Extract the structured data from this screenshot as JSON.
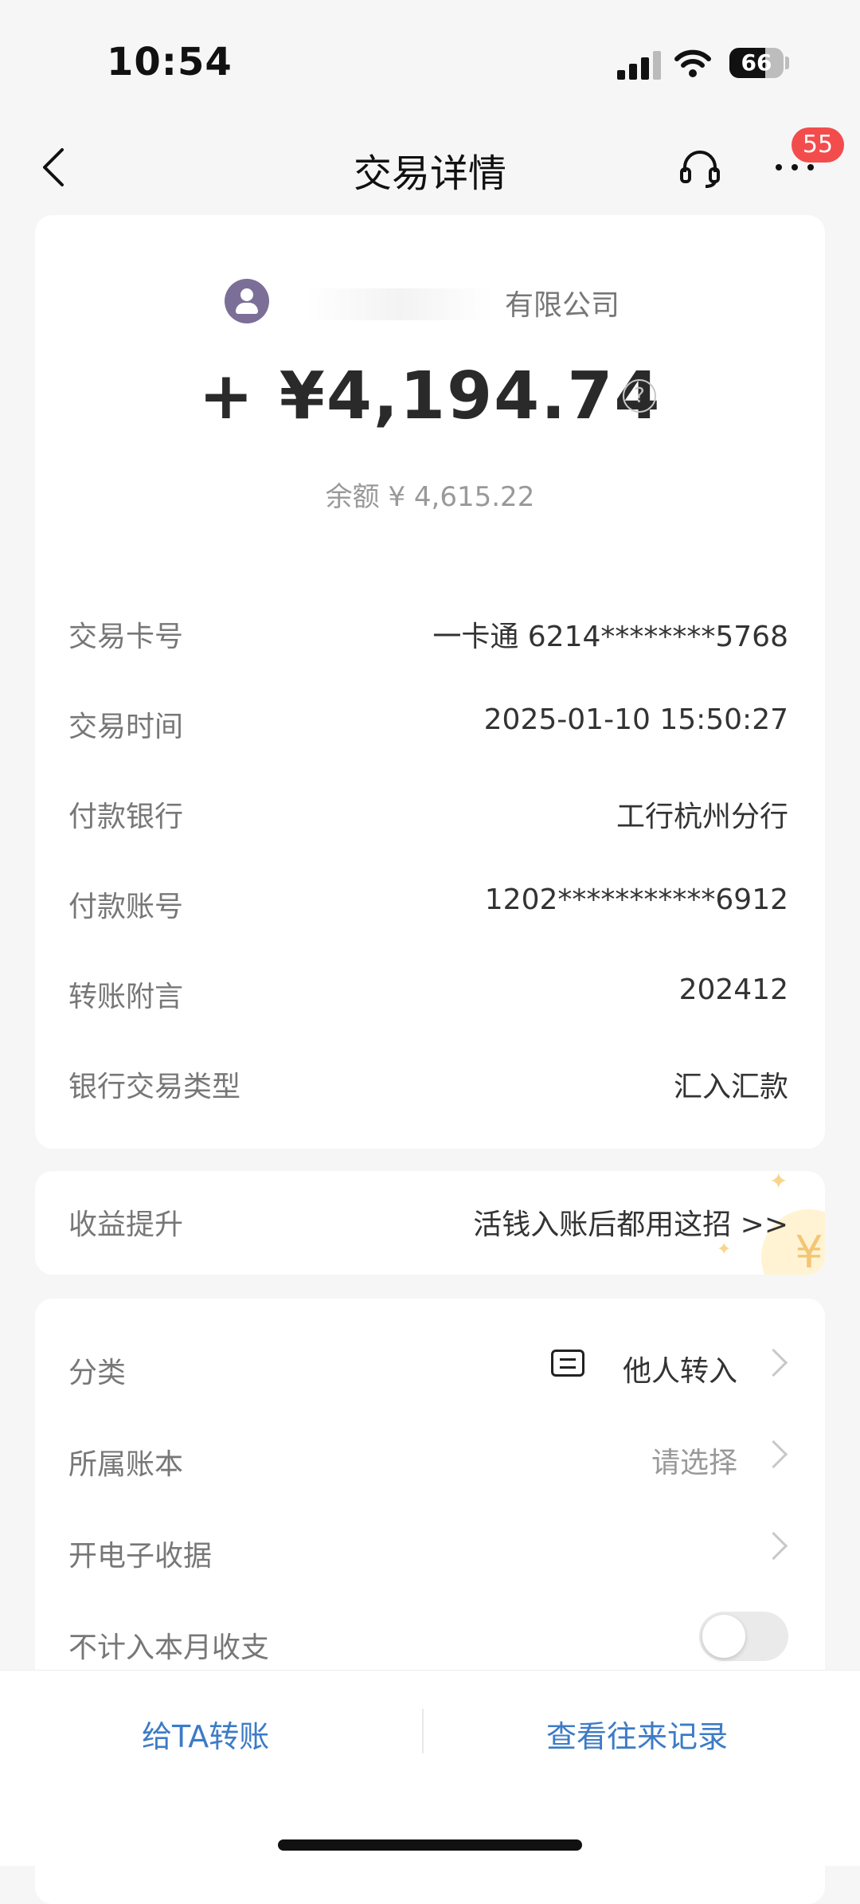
{
  "status_bar": {
    "time": "10:54",
    "battery": "66"
  },
  "header": {
    "title": "交易详情",
    "notification_count": "55"
  },
  "transaction": {
    "payer_name": "有限公司",
    "amount": "+ ¥4,194.74",
    "balance": "余额 ¥ 4,615.22"
  },
  "details": [
    {
      "label": "交易卡号",
      "value": "一卡通 6214********5768"
    },
    {
      "label": "交易时间",
      "value": "2025-01-10 15:50:27"
    },
    {
      "label": "付款银行",
      "value": "工行杭州分行"
    },
    {
      "label": "付款账号",
      "value": "1202***********6912"
    },
    {
      "label": "转账附言",
      "value": "202412"
    },
    {
      "label": "银行交易类型",
      "value": "汇入汇款"
    }
  ],
  "promo": {
    "label": "收益提升",
    "value": "活钱入账后都用这招 >>"
  },
  "options": {
    "category": {
      "label": "分类",
      "value": "他人转入"
    },
    "ledger": {
      "label": "所属账本",
      "value": "请选择"
    },
    "receipt": {
      "label": "开电子收据"
    },
    "exclude": {
      "label": "不计入本月收支",
      "enabled": false
    }
  },
  "footer": {
    "transfer_button": "给TA转账",
    "history_button": "查看往来记录"
  },
  "colors": {
    "accent": "#3d7bc6",
    "badge": "#f34c4c",
    "avatar": "#7b6f98"
  }
}
